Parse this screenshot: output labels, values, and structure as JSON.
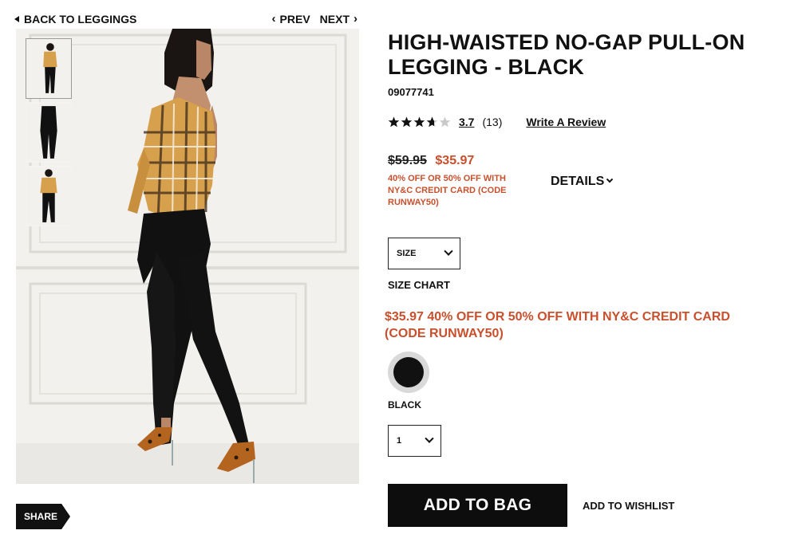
{
  "nav": {
    "back_label": "BACK TO LEGGINGS",
    "prev_label": "PREV",
    "next_label": "NEXT"
  },
  "gallery": {
    "thumbnail_count": 3,
    "active_thumbnail": 1
  },
  "share_label": "SHARE",
  "product": {
    "title": "HIGH-WAISTED NO-GAP PULL-ON LEGGING - BLACK",
    "sku": "09077741",
    "rating": "3.7",
    "rating_value": 3.7,
    "stars_max": 5,
    "review_count": "(13)",
    "write_review_label": "Write A Review",
    "original_price": "$59.95",
    "sale_price": "$35.97",
    "promo_text": "40% OFF OR 50% OFF WITH NY&C CREDIT CARD (CODE RUNWAY50)",
    "details_label": "DETAILS",
    "size_label": "SIZE",
    "size_chart_label": "SIZE CHART",
    "promo_banner": "$35.97 40% OFF OR 50% OFF WITH NY&C CREDIT CARD (CODE RUNWAY50)",
    "color_name": "BLACK",
    "quantity": "1",
    "add_to_bag_label": "ADD TO BAG",
    "wishlist_label": "ADD TO WISHLIST"
  },
  "colors": {
    "accent": "#c8502d",
    "button_bg": "#0d0d0d",
    "swatch_color": "#111111"
  },
  "icons": {
    "back": "triangle-left-icon",
    "prev": "chevron-left-icon",
    "next": "chevron-right-icon",
    "details": "chevron-down-icon",
    "size": "chevron-down-icon",
    "qty": "chevron-down-icon",
    "star": "star-icon"
  }
}
